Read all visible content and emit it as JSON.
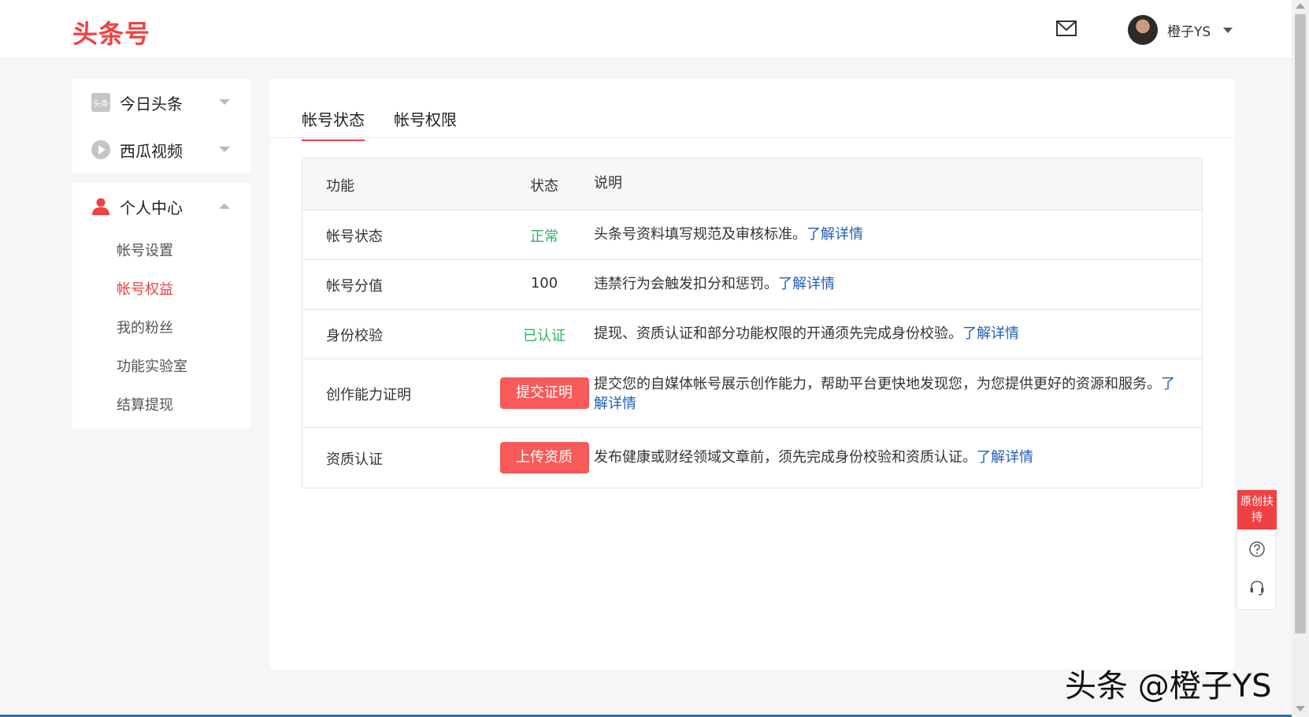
{
  "header": {
    "logo_text": "头条号",
    "username": "橙子YS"
  },
  "sidebar": {
    "platforms": [
      {
        "label": "今日头条",
        "icon": "toutiao-icon"
      },
      {
        "label": "西瓜视频",
        "icon": "xigua-play-icon"
      }
    ],
    "personal": {
      "label": "个人中心",
      "icon": "person-icon",
      "items": [
        "帐号设置",
        "帐号权益",
        "我的粉丝",
        "功能实验室",
        "结算提现"
      ],
      "active_index": 1
    }
  },
  "tabs": [
    "帐号状态",
    "帐号权限"
  ],
  "table": {
    "headers": [
      "功能",
      "状态",
      "说明"
    ],
    "rows": [
      {
        "feature": "帐号状态",
        "status": "正常",
        "desc": "头条号资料填写规范及审核标准。",
        "link": "了解详情"
      },
      {
        "feature": "帐号分值",
        "status": "100",
        "desc": "违禁行为会触发扣分和惩罚。",
        "link": "了解详情"
      },
      {
        "feature": "身份校验",
        "status": "已认证",
        "desc": "提现、资质认证和部分功能权限的开通须先完成身份校验。",
        "link": "了解详情"
      },
      {
        "feature": "创作能力证明",
        "status": "提交证明",
        "desc": "提交您的自媒体帐号展示创作能力，帮助平台更快地发现您，为您提供更好的资源和服务。",
        "link": "了解详情"
      },
      {
        "feature": "资质认证",
        "status": "上传资质",
        "desc": "发布健康或财经领域文章前，须先完成身份校验和资质认证。",
        "link": "了解详情"
      }
    ]
  },
  "float_panel": {
    "badge": "原创扶持",
    "icons": [
      "help-icon",
      "customer-service-icon"
    ]
  },
  "watermark": "头条 @橙子YS",
  "colors": {
    "brand": "#f04142",
    "success": "#2db55d",
    "button": "#f85959",
    "link": "#1f5fb4"
  }
}
